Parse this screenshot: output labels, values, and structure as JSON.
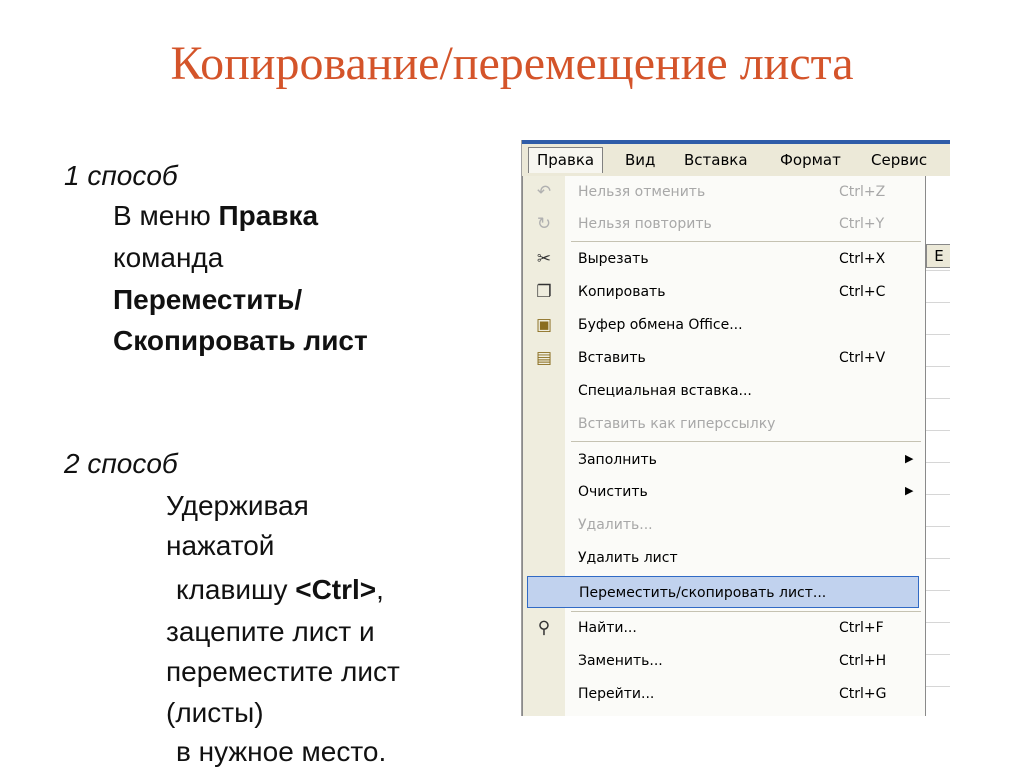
{
  "slide": {
    "title": "Копирование/перемещение листа",
    "method1": {
      "heading": "1 способ",
      "line1_prefix": "В меню ",
      "line1_bold": "Правка",
      "line2": "команда",
      "line3": "Переместить/",
      "line4": "Скопировать лист"
    },
    "method2": {
      "heading": "2 способ",
      "line1": "Удерживая",
      "line2": "нажатой",
      "line3_prefix": "клавишу ",
      "line3_bold": "<Ctrl>",
      "line3_suffix": ",",
      "line4": "зацепите лист и",
      "line5": "переместите лист",
      "line6": "(листы)",
      "line7": "в нужное место."
    }
  },
  "menubar": {
    "items": [
      "Правка",
      "Вид",
      "Вставка",
      "Формат",
      "Сервис"
    ]
  },
  "sheet": {
    "column_label": "E"
  },
  "edit_menu": {
    "items": [
      {
        "label": "Нельзя отменить",
        "shortcut": "Ctrl+Z",
        "icon": "undo-icon",
        "glyph": "↶"
      },
      {
        "label": "Нельзя повторить",
        "shortcut": "Ctrl+Y",
        "icon": "redo-icon",
        "glyph": "↻"
      },
      {
        "label": "Вырезать",
        "shortcut": "Ctrl+X",
        "icon": "scissors-icon",
        "glyph": "✂"
      },
      {
        "label": "Копировать",
        "shortcut": "Ctrl+C",
        "icon": "copy-icon",
        "glyph": "❐"
      },
      {
        "label": "Буфер обмена Office...",
        "shortcut": "",
        "icon": "clipboard-icon",
        "glyph": "▣"
      },
      {
        "label": "Вставить",
        "shortcut": "Ctrl+V",
        "icon": "paste-icon",
        "glyph": "▤"
      },
      {
        "label": "Специальная вставка...",
        "shortcut": "",
        "icon": "",
        "glyph": ""
      },
      {
        "label": "Вставить как гиперссылку",
        "shortcut": "",
        "icon": "",
        "glyph": ""
      },
      {
        "label": "Заполнить",
        "shortcut": "",
        "icon": "",
        "glyph": ""
      },
      {
        "label": "Очистить",
        "shortcut": "",
        "icon": "",
        "glyph": ""
      },
      {
        "label": "Удалить...",
        "shortcut": "",
        "icon": "",
        "glyph": ""
      },
      {
        "label": "Удалить лист",
        "shortcut": "",
        "icon": "",
        "glyph": ""
      },
      {
        "label": "Переместить/скопировать лист...",
        "shortcut": "",
        "icon": "",
        "glyph": ""
      },
      {
        "label": "Найти...",
        "shortcut": "Ctrl+F",
        "icon": "binoculars-icon",
        "glyph": "⚲"
      },
      {
        "label": "Заменить...",
        "shortcut": "Ctrl+H",
        "icon": "",
        "glyph": ""
      },
      {
        "label": "Перейти...",
        "shortcut": "Ctrl+G",
        "icon": "",
        "glyph": ""
      }
    ]
  },
  "colors": {
    "title": "#d4542a",
    "menu_highlight": "#c1d2ee",
    "menu_highlight_border": "#316ac5",
    "disabled_text": "#a8a8a8"
  }
}
